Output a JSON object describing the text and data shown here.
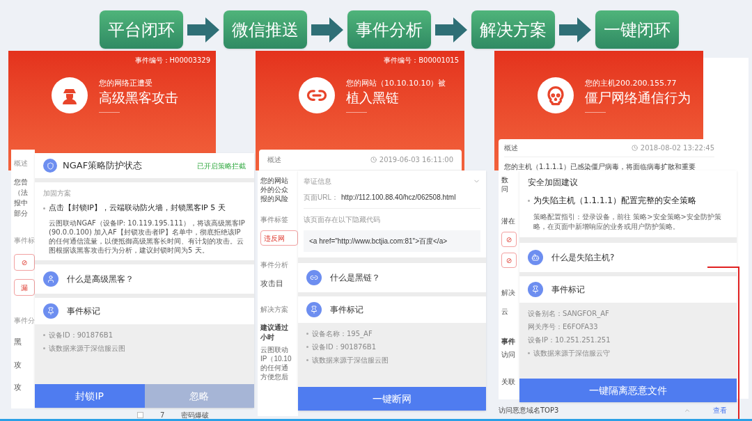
{
  "flow": {
    "steps": [
      {
        "label": "平台闭环"
      },
      {
        "label": "微信推送"
      },
      {
        "label": "事件分析"
      },
      {
        "label": "解决方案"
      },
      {
        "label": "一键闭环"
      }
    ]
  },
  "panels": [
    {
      "kind": "hacker",
      "header": {
        "event_id": "事件编号：H00003329",
        "subtitle": "您的网络正遭受",
        "title": "高级黑客攻击"
      },
      "back": {
        "summary_label": "概述",
        "summary_lines": [
          "您曾",
          "（法",
          "报中",
          "部分"
        ],
        "tags_label": "事件标",
        "tags": [
          {
            "text": "⊘"
          },
          {
            "text": "漏"
          }
        ],
        "analysis_label": "事件分",
        "analysis_items": [
          "黑",
          "攻",
          "攻"
        ],
        "table_row": {
          "checked": false,
          "index": "7",
          "name": "密码爆破"
        }
      },
      "card": {
        "policy_title": "NGAF策略防护状态",
        "policy_status": "已开启策略拦截",
        "plan_label": "加固方案",
        "plan_headline": "点击【封锁IP】，云端联动防火墙，封锁黑客IP 5 天",
        "plan_detail": "云图联动NGAF（设备IP: 10.119.195.111），将该高级黑客IP (90.0.0.100) 加入AF【封锁攻击者IP】名单中，彻底拒绝该IP的任何通信流量，以便抵御高级黑客长时间、有计划的攻击。云图根据该黑客攻击行为分析，建议封锁时间为5 天。",
        "faq": "什么是高级黑客？",
        "mark_title": "事件标记",
        "mark_items": [
          {
            "text": "设备ID：901876B1",
            "bullet": true
          },
          {
            "text": "该数据来源于深信服云图",
            "bullet": true
          }
        ],
        "buttons": [
          {
            "label": "封锁IP",
            "kind": "primary"
          },
          {
            "label": "忽略",
            "kind": "secondary"
          }
        ]
      }
    },
    {
      "kind": "link",
      "header": {
        "event_id": "事件编号：B00001015",
        "subtitle": "您的网站（10.10.10.10）被",
        "title": "植入黑链"
      },
      "back": {
        "summary_label": "概述",
        "summary_time": "2019-06-03 16:11:00",
        "summary_lines": [
          "您的网站",
          "外的公众",
          "报的风险"
        ],
        "tags_label": "事件标签",
        "tags": [
          {
            "text": "违反网"
          }
        ],
        "analysis_label": "事件分析",
        "analysis_items": [
          "攻击目"
        ],
        "solution_label": "解决方案",
        "solution_headline": [
          "建议通过",
          "小时"
        ],
        "solution_detail": [
          "云图联动",
          "IP（10.10",
          "的任何通",
          "方便您后"
        ]
      },
      "card": {
        "evidence_label": "举证信息",
        "url_label": "页面URL：",
        "url": "http://112.100.88.40/hcz/062508.html",
        "code_label": "该页面存在以下隐藏代码",
        "code": "<a href=\"http://www.bctjia.com:81\">百度</a>",
        "faq": "什么是黑链？",
        "mark_title": "事件标记",
        "mark_items": [
          {
            "text": "设备名称：195_AF",
            "bullet": true
          },
          {
            "text": "设备ID：901876B1",
            "bullet": true
          },
          {
            "text": "该数据来源于深信服云图",
            "bullet": true
          }
        ],
        "buttons": [
          {
            "label": "一键断网",
            "kind": "primary"
          }
        ]
      }
    },
    {
      "kind": "skull",
      "header": {
        "subtitle": "您的主机200.200.155.77",
        "title": "僵尸网络通信行为"
      },
      "back": {
        "summary_label": "概述",
        "summary_time": "2018-08-02 13:22:45",
        "summary_first_line": "您的主机（1.1.1.1）已感染僵尸病毒，将面临病毒扩散和重要",
        "summary_lines": [
          "数",
          "问"
        ],
        "tags_label": "潜在",
        "tags": [
          {
            "text": "⊘"
          },
          {
            "text": "⊘"
          }
        ],
        "solution_label": "解决",
        "solution_headline": [
          "云"
        ],
        "events_label": "事件",
        "event_rows": [
          "访问",
          "关联",
          "访问恶意域名TOP3"
        ],
        "view_link": "查看"
      },
      "card": {
        "advice_label": "安全加固建议",
        "advice_headline": "为失陷主机（1.1.1.1）配置完整的安全策略",
        "advice_detail": "策略配置指引：登录设备，前往 策略>安全策略>安全防护策略，在页面中新增响应的业务或用户防护策略。",
        "faq": "什么是失陷主机?",
        "mark_title": "事件标记",
        "mark_items": [
          {
            "text": "设备别名：SANGFOR_AF",
            "bullet": false
          },
          {
            "text": "网关序号：E6FOFA33",
            "bullet": false
          },
          {
            "text": "设备IP：10.251.251.251",
            "bullet": false
          },
          {
            "text": "该数据来源于深信服云守",
            "bullet": true
          }
        ],
        "buttons": [
          {
            "label": "一键隔离恶意文件",
            "kind": "primary"
          }
        ]
      }
    }
  ]
}
